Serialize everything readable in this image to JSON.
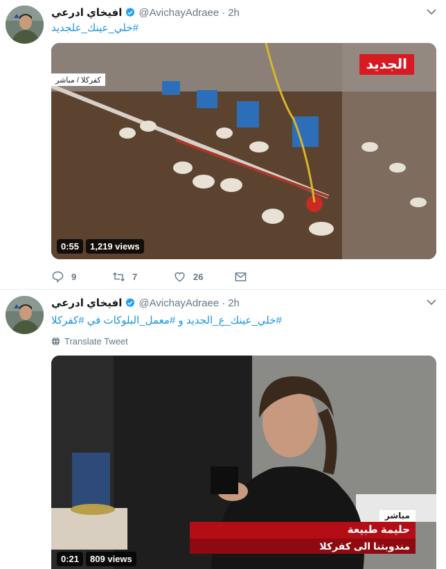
{
  "tweets": [
    {
      "name": "افيخاي ادرعي",
      "handle": "@AvichayAdraee",
      "separator": "·",
      "time": "2h",
      "text": "#خلي_عينك_علجديد",
      "video": {
        "duration": "0:55",
        "views": "1,219 views",
        "chyron": "كفركلا / مباشر",
        "logo": "الجديد"
      },
      "stats": {
        "replies": "9",
        "retweets": "7",
        "likes": "26"
      }
    },
    {
      "name": "افيخاي ادرعي",
      "handle": "@AvichayAdraee",
      "separator": "·",
      "time": "2h",
      "text": "#خلي_عينك_ع_الجديد و #معمل_البلوكات في #كفركلا",
      "translate": "Translate Tweet",
      "video": {
        "duration": "0:21",
        "views": "809 views",
        "live": "مباشر",
        "reporter": "حليمة طبيعة",
        "role": "مندوبتنا الى كفركلا"
      }
    }
  ],
  "colors": {
    "link": "#1b95e0",
    "muted": "#657786",
    "verified": "#1da1f2"
  }
}
